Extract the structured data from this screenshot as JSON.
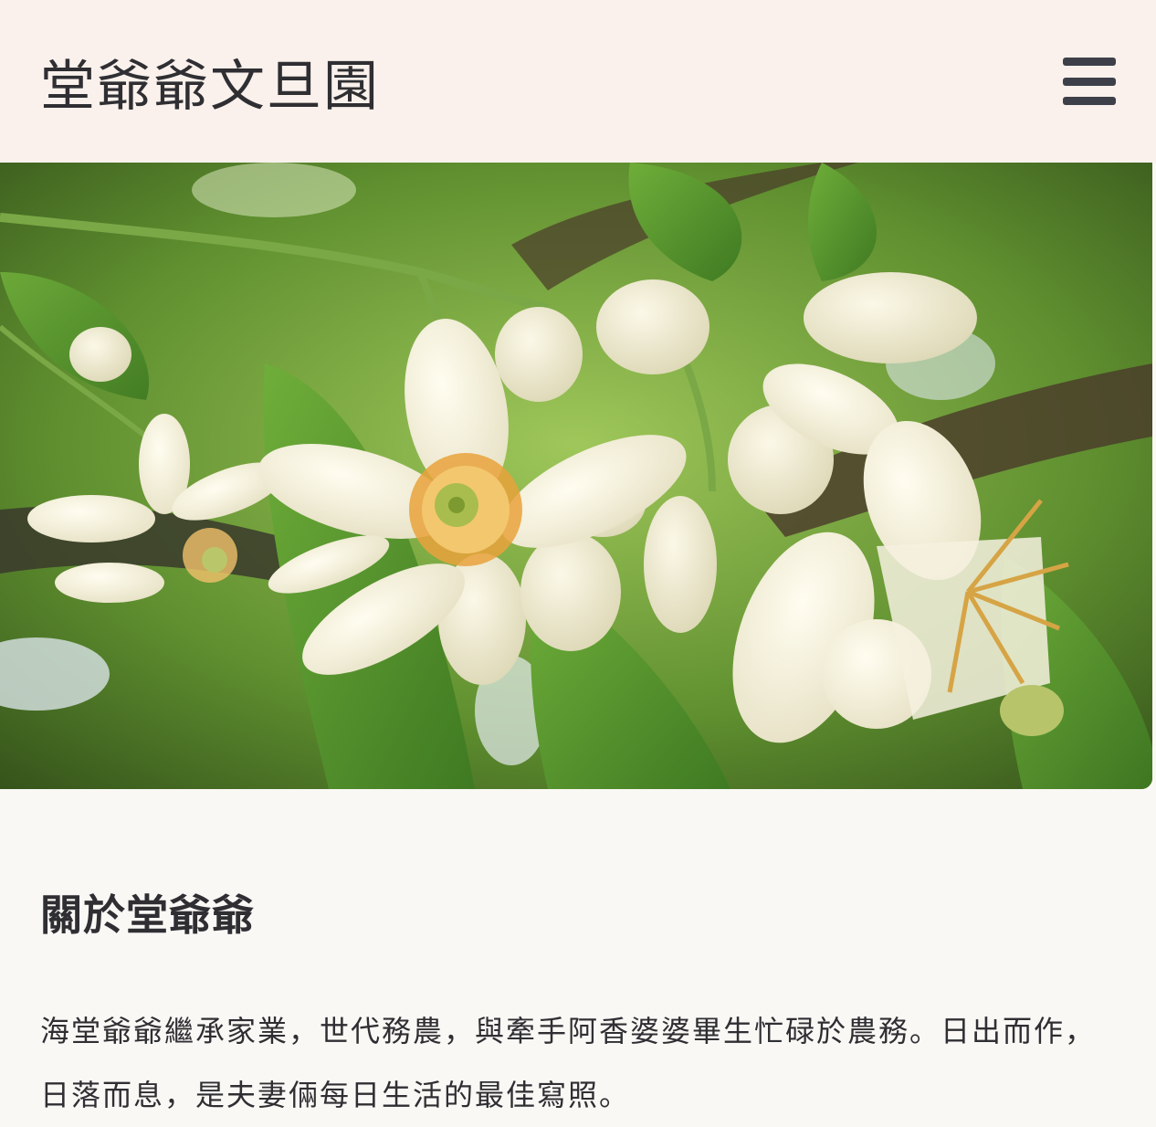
{
  "header": {
    "site_title": "堂爺爺文旦園",
    "menu_icon": "hamburger-menu-icon"
  },
  "hero": {
    "image_description_icon": "pomelo-blossom-photo"
  },
  "about": {
    "title": "關於堂爺爺",
    "body": "海堂爺爺繼承家業，世代務農，與牽手阿香婆婆畢生忙碌於農務。日出而作，日落而息，是夫妻倆每日生活的最佳寫照。"
  },
  "colors": {
    "header_bg": "#faf1ec",
    "page_bg": "#faf8f5",
    "text": "#2f2f33",
    "icon": "#3d4049"
  }
}
